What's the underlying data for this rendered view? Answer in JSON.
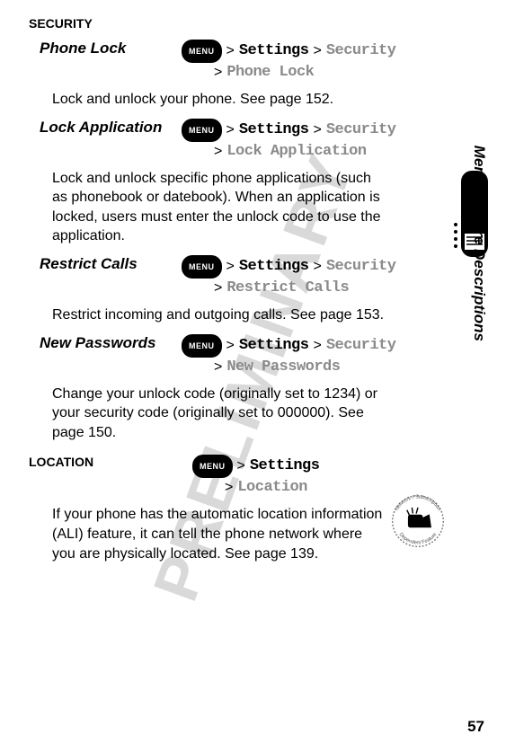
{
  "watermark": "PRELIMINARY",
  "side_tab": "Menu Feature Descriptions",
  "page_number": "57",
  "menu_label": "MENU",
  "sep": ">",
  "security": {
    "title": "SECURITY",
    "phone_lock": {
      "name": "Phone Lock",
      "p1": "Settings",
      "p2": "Security",
      "p3": "Phone Lock",
      "desc": "Lock and unlock your phone. See page 152."
    },
    "lock_app": {
      "name": "Lock Application",
      "p1": "Settings",
      "p2": "Security",
      "p3": "Lock Application",
      "desc": "Lock and unlock specific phone applications (such as phonebook or datebook). When an application is locked, users must enter the unlock code to use the application."
    },
    "restrict": {
      "name": "Restrict Calls",
      "p1": "Settings",
      "p2": "Security",
      "p3": "Restrict Calls",
      "desc": "Restrict incoming and outgoing calls. See page 153."
    },
    "newpwd": {
      "name": "New Passwords",
      "p1": "Settings",
      "p2": "Security",
      "p3": "New Passwords",
      "desc": "Change your unlock code (originally set to 1234) or your security code (originally set to 000000). See page 150."
    }
  },
  "location": {
    "title": "LOCATION",
    "p1": "Settings",
    "p2": "Location",
    "desc": "If your phone has the automatic location information (ALI) feature, it can tell the phone network where you are physically located. See page 139."
  },
  "badge": {
    "top": "Network / Subscription",
    "bottom": "Dependent   Feature"
  }
}
